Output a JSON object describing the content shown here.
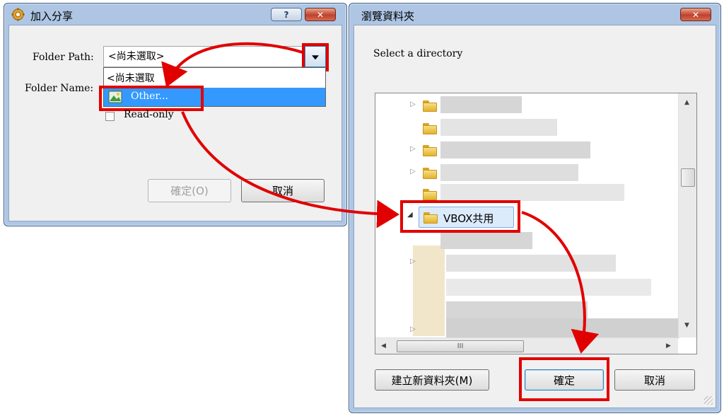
{
  "dialog_add_share": {
    "title": "加入分享",
    "help_label": "?",
    "close_label": "✕",
    "folder_path_label": "Folder Path:",
    "folder_path_value": "<尚未選取>",
    "folder_name_label": "Folder Name:",
    "dropdown_options": [
      "<尚未選取",
      "Other..."
    ],
    "readonly_label": "Read-only",
    "ok_label": "確定(O)",
    "cancel_label": "取消"
  },
  "dialog_browse": {
    "title": "瀏覽資料夾",
    "close_label": "✕",
    "instruction": "Select a directory",
    "selected_folder": "VBOX共用",
    "hscroll_thumb_label": "III",
    "new_folder_label": "建立新資料夾(M)",
    "ok_label": "確定",
    "cancel_label": "取消"
  },
  "colors": {
    "annotation_red": "#e10000",
    "selection_blue": "#3399ff",
    "window_frame": "#aec6e4"
  }
}
